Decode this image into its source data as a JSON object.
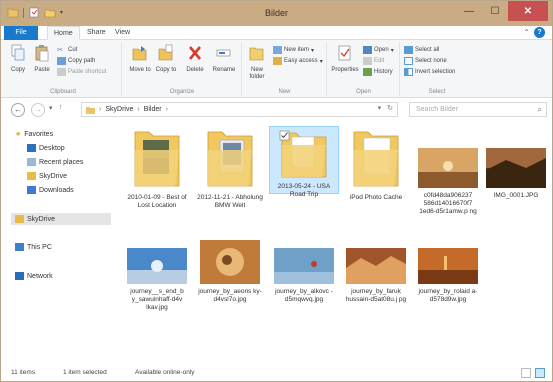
{
  "window": {
    "title": "Bilder",
    "minimize": "—",
    "maximize": "☐",
    "close": "✕",
    "colors": {
      "titlebar": "#c9ab84",
      "file_tab": "#1979ca",
      "close": "#c75050",
      "selection": "#cce8ff"
    }
  },
  "tabs": {
    "file": "File",
    "home": "Home",
    "share": "Share",
    "view": "View",
    "help": "?"
  },
  "ribbon": {
    "clipboard": {
      "copy": "Copy",
      "paste": "Paste",
      "cut": "Cut",
      "copy_path": "Copy path",
      "paste_shortcut": "Paste shortcut",
      "label": "Clipboard"
    },
    "organize": {
      "move_to": "Move to",
      "copy_to": "Copy to",
      "delete": "Delete",
      "rename": "Rename",
      "label": "Organize"
    },
    "new": {
      "new_folder": "New folder",
      "new_item": "New item",
      "easy_access": "Easy access",
      "label": "New"
    },
    "open": {
      "properties": "Properties",
      "open": "Open",
      "edit": "Edit",
      "history": "History",
      "label": "Open"
    },
    "select": {
      "select_all": "Select all",
      "select_none": "Select none",
      "invert_selection": "Invert selection",
      "label": "Select"
    }
  },
  "address": {
    "crumbs": [
      "SkyDrive",
      "Bilder"
    ],
    "search_placeholder": "Search Bilder"
  },
  "nav": {
    "favorites": "Favorites",
    "desktop": "Desktop",
    "recent_places": "Recent places",
    "skydrive_fav": "SkyDrive",
    "downloads": "Downloads",
    "skydrive": "SkyDrive",
    "this_pc": "This PC",
    "network": "Network"
  },
  "items": [
    {
      "label": "2010-01-09 - Best of Lost Location",
      "kind": "folder",
      "selected": false
    },
    {
      "label": "2012-11-21 - Abholung BMW Welt",
      "kind": "folder",
      "selected": false
    },
    {
      "label": "2013-05-24 - USA Road Trip",
      "kind": "folder",
      "selected": true
    },
    {
      "label": "iPod Photo Cache",
      "kind": "folder",
      "selected": false
    },
    {
      "label": "c0fd48da906237 586d14016670f7 1ed6-d5r1amw.p ng",
      "kind": "image",
      "selected": false
    },
    {
      "label": "IMG_0001.JPG",
      "kind": "image",
      "selected": false
    },
    {
      "label": "journey__s_end_b y_sawuinhaff-d4v lkav.jpg",
      "kind": "image",
      "selected": false
    },
    {
      "label": "journey_by_aeons ky-d4vsl7o.jpg",
      "kind": "image",
      "selected": false
    },
    {
      "label": "journey_by_alkovc -d5mqwvq.jpg",
      "kind": "image",
      "selected": false
    },
    {
      "label": "journey_by_faruk hussain-d5at08u.j pg",
      "kind": "image",
      "selected": false
    },
    {
      "label": "journey_by_rolaid a-d578d9w.jpg",
      "kind": "image",
      "selected": false
    }
  ],
  "status": {
    "count": "11 items",
    "selected": "1 item selected",
    "availability": "Available online-only"
  }
}
